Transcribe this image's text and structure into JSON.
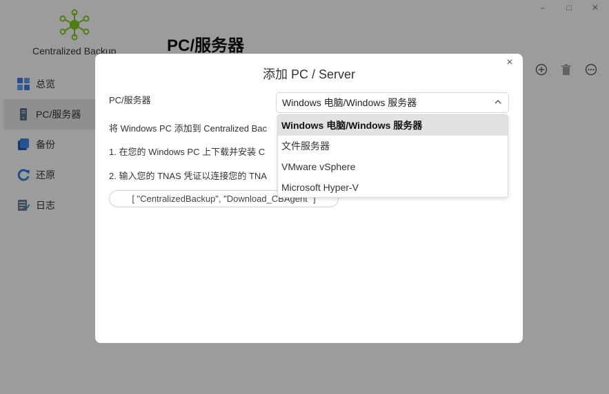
{
  "app": {
    "name": "Centralized Backup",
    "page_title": "PC/服务器",
    "window_controls": [
      "minimize-icon",
      "maximize-icon",
      "close-icon"
    ]
  },
  "sidebar": {
    "items": [
      {
        "label": "总览",
        "icon": "dashboard-icon",
        "active": false
      },
      {
        "label": "PC/服务器",
        "icon": "server-icon",
        "active": true
      },
      {
        "label": "备份",
        "icon": "backup-icon",
        "active": false
      },
      {
        "label": "还原",
        "icon": "restore-icon",
        "active": false
      },
      {
        "label": "日志",
        "icon": "log-icon",
        "active": false
      }
    ]
  },
  "toolbar": {
    "icons": [
      "add-icon",
      "delete-icon",
      "more-icon"
    ]
  },
  "modal": {
    "title": "添加 PC / Server",
    "close_glyph": "×",
    "field_label": "PC/服务器",
    "selected_value": "Windows 电脑/Windows 服务器",
    "line1": "将 Windows PC 添加到 Centralized Bac",
    "line2": "1. 在您的 Windows PC 上下载并安装 C",
    "line3": "2. 输入您的 TNAS 凭证以连接您的 TNA",
    "download_button": "[ \"CentralizedBackup\", \"Download_CBAgent\" ]",
    "options": [
      "Windows 电脑/Windows 服务器",
      "文件服务器",
      "VMware vSphere",
      "Microsoft Hyper-V"
    ]
  },
  "colors": {
    "logo_green": "#7ac51c",
    "overlay": "rgba(0,0,0,0.36)",
    "selected_option_bg": "#e2e2e2"
  }
}
